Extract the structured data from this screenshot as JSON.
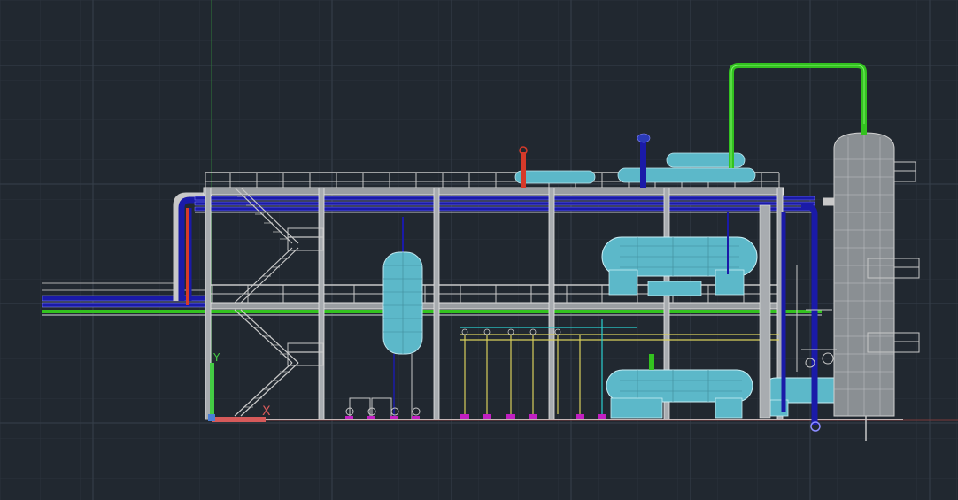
{
  "app": {
    "type": "cad-model-space-viewport",
    "background_color": "#212830",
    "grid_color": "#2e3742",
    "grid_major_color": "#38424e"
  },
  "ucs_icon": {
    "x_label": "X",
    "y_label": "Y",
    "x_axis_color": "#d65a5a",
    "y_axis_color": "#44cc44",
    "z_marker_color": "#4a7fd6"
  },
  "layer_colors": {
    "structure": "#c8c8c8",
    "process_blue": "#1a1aa8",
    "vent_green": "#33c21f",
    "vessel_fill": "#5cb8c9",
    "relief_red": "#d63a2a",
    "instrument_yellow": "#d9d05b",
    "nozzle_magenta": "#c21fc2",
    "cyan_line": "#2ad0d0",
    "column_fill": "#8a8f93"
  },
  "drawing": {
    "description_visible": false
  }
}
